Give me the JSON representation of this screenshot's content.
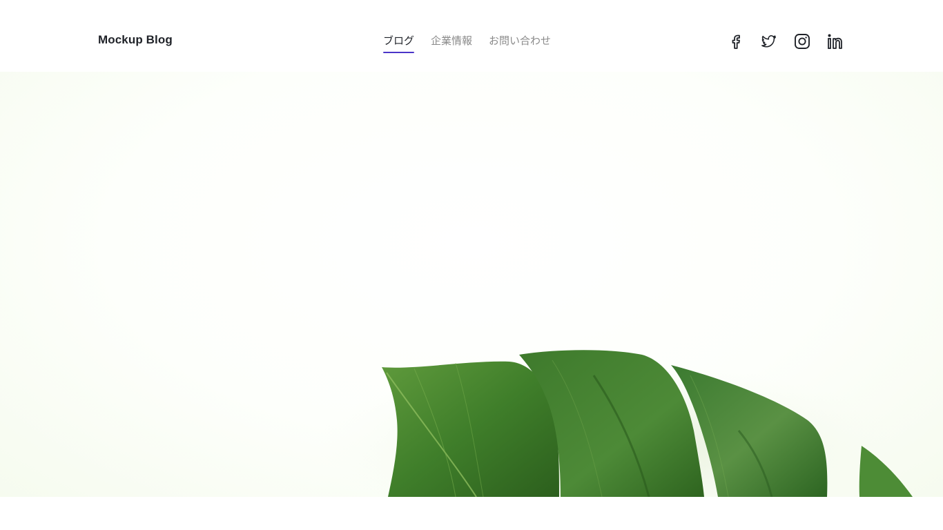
{
  "header": {
    "logo": "Mockup Blog",
    "nav": [
      {
        "label": "ブログ",
        "active": true
      },
      {
        "label": "企業情報",
        "active": false
      },
      {
        "label": "お問い合わせ",
        "active": false
      }
    ],
    "social_icons": [
      "facebook-icon",
      "twitter-icon",
      "instagram-icon",
      "linkedin-icon"
    ]
  },
  "hero": {
    "image": "monstera-leaf",
    "colors": {
      "accent": "#4a35c8",
      "leaf_dark": "#2f6a21",
      "leaf_mid": "#4f8f34",
      "leaf_light": "#7fb04f"
    }
  }
}
